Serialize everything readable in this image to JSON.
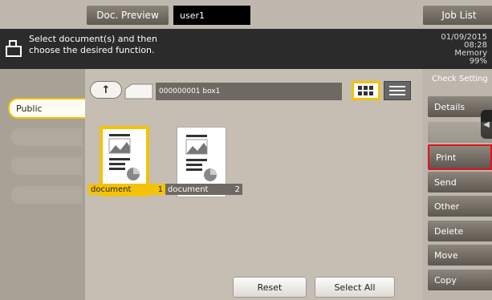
{
  "header": {
    "doc_preview_tab": "Doc. Preview",
    "user_field": "user1",
    "job_list_tab": "Job List"
  },
  "message": {
    "line1": "Select document(s) and then",
    "line2": "choose the desired function.",
    "date": "01/09/2015",
    "time": "08:28",
    "memory_label": "Memory",
    "memory_value": "99%"
  },
  "left_tabs": [
    {
      "label": "Public",
      "active": true
    }
  ],
  "folder": {
    "box_name": "000000001 box1"
  },
  "documents": [
    {
      "name": "document",
      "number": "1",
      "selected": true
    },
    {
      "name": "document",
      "number": "2",
      "selected": false
    }
  ],
  "bottom_buttons": {
    "reset": "Reset",
    "select_all": "Select All"
  },
  "side_menu": [
    {
      "label": "Check Setting"
    },
    {
      "label": "Details"
    },
    {
      "label": "Print",
      "highlighted": true
    },
    {
      "label": "Send"
    },
    {
      "label": "Other"
    },
    {
      "label": "Delete"
    },
    {
      "label": "Move"
    },
    {
      "label": "Copy"
    }
  ],
  "colors": {
    "accent": "#f3c20b",
    "highlight": "#e0131b"
  }
}
